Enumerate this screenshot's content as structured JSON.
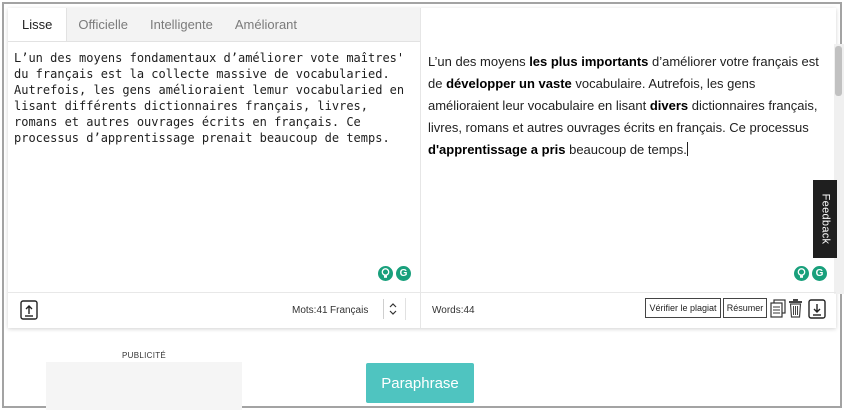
{
  "tabs": [
    {
      "label": "Lisse",
      "active": true
    },
    {
      "label": "Officielle",
      "active": false
    },
    {
      "label": "Intelligente",
      "active": false
    },
    {
      "label": "Améliorant",
      "active": false
    }
  ],
  "input": {
    "text": "L’un des moyens fondamentaux d’améliorer vote maîtres' du français est la collecte massive de vocabularied. Autrefois, les gens amélioraient lemur vocabularied en lisant différents dictionnaires français, livres, romans et autres ouvrages écrits en français. Ce processus d’apprentissage prenait beaucoup de temps."
  },
  "output": {
    "segments": [
      {
        "t": "L’un des moyens ",
        "b": false
      },
      {
        "t": "les plus importants",
        "b": true
      },
      {
        "t": " d’améliorer votre  français est  de ",
        "b": false
      },
      {
        "t": "développer un vaste",
        "b": true
      },
      {
        "t": " vocabulaire. Autrefois, les gens amélioraient leur vocabulaire en lisant ",
        "b": false
      },
      {
        "t": "divers",
        "b": true
      },
      {
        "t": " dictionnaires français, livres, romans et autres ouvrages écrits en français. Ce processus ",
        "b": false
      },
      {
        "t": "d'apprentissage a pris",
        "b": true
      },
      {
        "t": " beaucoup de temps.",
        "b": false
      }
    ]
  },
  "left_footer": {
    "word_count": "Mots:41",
    "language": "Français"
  },
  "right_footer": {
    "word_count": "Words:44",
    "check_plagiarism_label": "Vérifier le plagiat",
    "summarize_label": "Résumer"
  },
  "feedback_label": "Feedback",
  "ad_label": "PUBLICITÉ",
  "paraphrase_label": "Paraphrase",
  "icons": {
    "upload": "upload-icon",
    "download": "download-icon",
    "copy": "copy-icon",
    "trash": "trash-icon",
    "bulb": "lightbulb-icon",
    "grammarly": "grammarly-icon",
    "chevron": "chevron-updown-icon"
  },
  "colors": {
    "accent": "#4fc4c0",
    "assist_green": "#19a07c"
  }
}
